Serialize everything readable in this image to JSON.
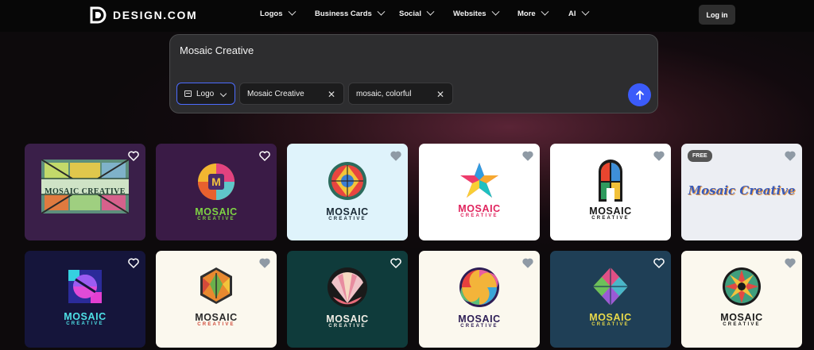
{
  "brand": {
    "name": "DESIGN.COM"
  },
  "nav": {
    "items": [
      "Logos",
      "Business Cards",
      "Social",
      "Websites",
      "More",
      "AI"
    ],
    "login_label": "Log in"
  },
  "prompt": {
    "text": "Mosaic Creative",
    "type_chip": "Logo",
    "name_chip": "Mosaic Creative",
    "keywords_chip": "mosaic, colorful",
    "submit_icon": "arrow-up-icon"
  },
  "results": {
    "free_badge": "FREE",
    "cards": [
      {
        "name": "MOSAIC CREATIVE",
        "sub": "",
        "bg": "#3a1f49"
      },
      {
        "name": "MOSAIC",
        "sub": "CREATIVE",
        "bg": "#3a1b46"
      },
      {
        "name": "MOSAIC",
        "sub": "CREATIVE",
        "bg": "#dff3fb"
      },
      {
        "name": "MOSAIC",
        "sub": "CREATIVE",
        "bg": "#ffffff"
      },
      {
        "name": "MOSAIC",
        "sub": "CREATIVE",
        "bg": "#ffffff"
      },
      {
        "name": "Mosaic Creative",
        "sub": "",
        "bg": "#eceef3"
      },
      {
        "name": "MOSAIC",
        "sub": "CREATIVE",
        "bg": "#15153b"
      },
      {
        "name": "MOSAIC",
        "sub": "CREATIVE",
        "bg": "#fbf8ee"
      },
      {
        "name": "MOSAIC",
        "sub": "CREATIVE",
        "bg": "#0f3b3b"
      },
      {
        "name": "MOSAIC",
        "sub": "CREATIVE",
        "bg": "#fbf8ee"
      },
      {
        "name": "MOSAIC",
        "sub": "CREATIVE",
        "bg": "#1f3f56"
      },
      {
        "name": "MOSAIC",
        "sub": "CREATIVE",
        "bg": "#fbf8ee"
      }
    ]
  }
}
